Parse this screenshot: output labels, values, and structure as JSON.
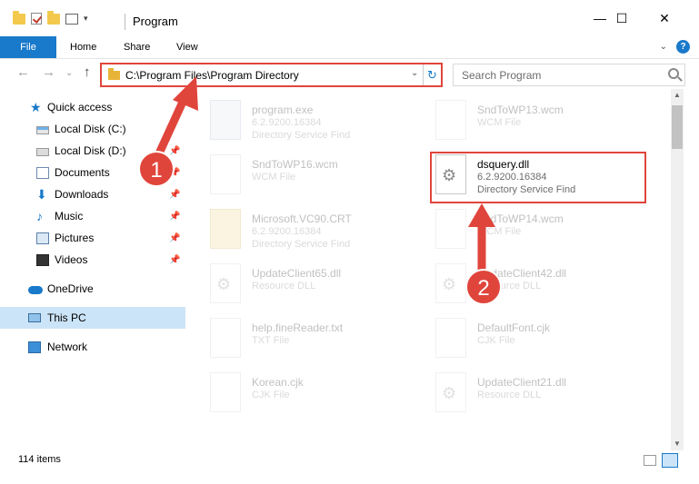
{
  "window": {
    "title": "Program",
    "minimize_glyph": "—",
    "maximize_glyph": "☐",
    "close_glyph": "✕"
  },
  "ribbon": {
    "tabs": [
      {
        "label": "File",
        "active": true
      },
      {
        "label": "Home"
      },
      {
        "label": "Share"
      },
      {
        "label": "View"
      }
    ],
    "help_label": "?",
    "collapse_glyph": "⌄"
  },
  "nav": {
    "back_glyph": "←",
    "forward_glyph": "→",
    "recent_glyph": "⌄",
    "up_glyph": "↑",
    "address": "C:\\Program Files\\Program Directory",
    "address_dropdown_glyph": "⌄",
    "refresh_glyph": "↻",
    "search_placeholder": "Search Program"
  },
  "sidebar": {
    "items": [
      {
        "label": "Quick access",
        "icon": "star-icon",
        "pinned": false
      },
      {
        "label": "Local Disk (C:)",
        "icon": "disk-icon",
        "pinned": false
      },
      {
        "label": "Local Disk (D:)",
        "icon": "disk-icon",
        "pinned": true
      },
      {
        "label": "Documents",
        "icon": "documents-icon",
        "pinned": true
      },
      {
        "label": "Downloads",
        "icon": "download-icon",
        "pinned": true
      },
      {
        "label": "Music",
        "icon": "music-icon",
        "pinned": true
      },
      {
        "label": "Pictures",
        "icon": "pictures-icon",
        "pinned": true
      },
      {
        "label": "Videos",
        "icon": "videos-icon",
        "pinned": true
      },
      {
        "label": "OneDrive",
        "icon": "onedrive-icon",
        "pinned": false
      },
      {
        "label": "This PC",
        "icon": "this-pc-icon",
        "pinned": false,
        "selected": true
      },
      {
        "label": "Network",
        "icon": "network-icon",
        "pinned": false
      }
    ],
    "pin_glyph": "📌"
  },
  "files": [
    {
      "name": "program.exe",
      "version": "6.2.9200.16384",
      "type": "Directory Service Find",
      "icon": "exe-icon",
      "faded": true
    },
    {
      "name": "SndToWP13.wcm",
      "version": "",
      "type": "WCM File",
      "icon": "file-icon",
      "faded": true
    },
    {
      "name": "SndToWP16.wcm",
      "version": "",
      "type": "WCM File",
      "icon": "file-icon",
      "faded": true
    },
    {
      "name": "dsquery.dll",
      "version": "6.2.9200.16384",
      "type": "Directory Service Find",
      "icon": "dll-icon",
      "faded": false,
      "highlighted": true
    },
    {
      "name": "Microsoft.VC90.CRT",
      "version": "6.2.9200.16384",
      "type": "Directory Service Find",
      "icon": "folder-icon",
      "faded": true
    },
    {
      "name": "SndToWP14.wcm",
      "version": "",
      "type": "WCM File",
      "icon": "file-icon",
      "faded": true
    },
    {
      "name": "UpdateClient65.dll",
      "version": "",
      "type": "Resource DLL",
      "icon": "dll-icon",
      "faded": true
    },
    {
      "name": "UpdateClient42.dll",
      "version": "",
      "type": "Resource DLL",
      "icon": "dll-icon",
      "faded": true
    },
    {
      "name": "help.fineReader.txt",
      "version": "",
      "type": "TXT File",
      "icon": "file-icon",
      "faded": true
    },
    {
      "name": "DefaultFont.cjk",
      "version": "",
      "type": "CJK File",
      "icon": "file-icon",
      "faded": true
    },
    {
      "name": "Korean.cjk",
      "version": "",
      "type": "CJK File",
      "icon": "file-icon",
      "faded": true
    },
    {
      "name": "UpdateClient21.dll",
      "version": "",
      "type": "Resource DLL",
      "icon": "dll-icon",
      "faded": true
    }
  ],
  "status": {
    "item_count": "114 items"
  },
  "callouts": [
    {
      "number": "1"
    },
    {
      "number": "2"
    }
  ],
  "colors": {
    "accent": "#1979ca",
    "highlight": "#e0453c",
    "selection": "#cce4f7"
  }
}
